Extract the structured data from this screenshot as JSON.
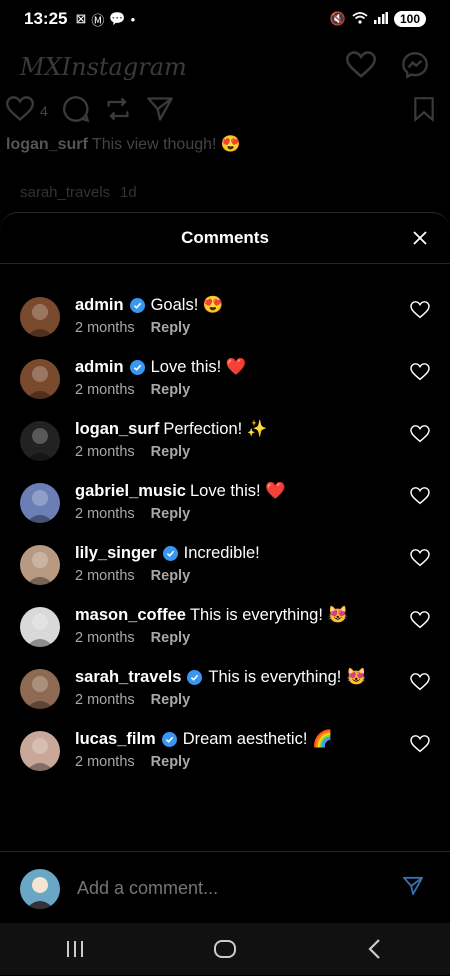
{
  "status_bar": {
    "time": "13:25",
    "battery": "100"
  },
  "background": {
    "app_logo": "MXInstagram",
    "like_count": "4",
    "caption_user": "logan_surf",
    "caption_text": "This view though! 😍",
    "faded_comment_user": "sarah_travels",
    "faded_comment_time": "1d"
  },
  "comments_sheet": {
    "title": "Comments",
    "reply_label": "Reply",
    "comments": [
      {
        "user": "admin",
        "verified": true,
        "text": "Goals! 😍",
        "time": "2 months",
        "avatar_color": "#7a4a2e"
      },
      {
        "user": "admin",
        "verified": true,
        "text": "Love this! ❤️",
        "time": "2 months",
        "avatar_color": "#7a4a2e"
      },
      {
        "user": "logan_surf",
        "verified": false,
        "text": "Perfection! ✨",
        "time": "2 months",
        "avatar_color": "#222"
      },
      {
        "user": "gabriel_music",
        "verified": false,
        "text": "Love this! ❤️",
        "time": "2 months",
        "avatar_color": "#6b7fb5"
      },
      {
        "user": "lily_singer",
        "verified": true,
        "text": "Incredible!",
        "time": "2 months",
        "avatar_color": "#b89a82"
      },
      {
        "user": "mason_coffee",
        "verified": false,
        "text": "This is everything! 😻",
        "time": "2 months",
        "avatar_color": "#d9d9d9"
      },
      {
        "user": "sarah_travels",
        "verified": true,
        "text": "This is everything! 😻",
        "time": "2 months",
        "avatar_color": "#8f6a52"
      },
      {
        "user": "lucas_film",
        "verified": true,
        "text": "Dream aesthetic! 🌈",
        "time": "2 months",
        "avatar_color": "#c9a89a"
      }
    ],
    "add_comment_placeholder": "Add a comment..."
  },
  "colors": {
    "accent": "#3897f0",
    "muted_text": "#a8a8a8",
    "send_icon": "#3a6fb0"
  }
}
